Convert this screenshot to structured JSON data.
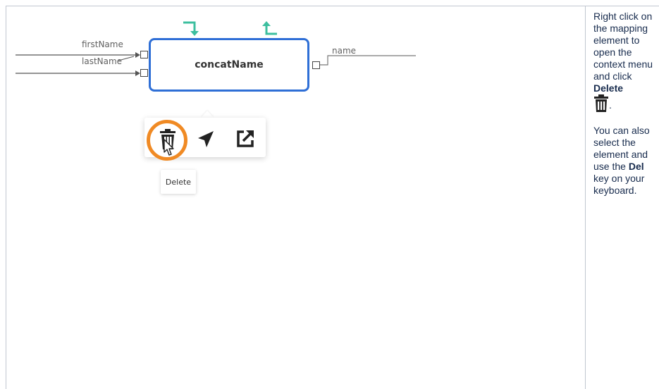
{
  "node": {
    "title": "concatName",
    "inputs": [
      "firstName",
      "lastName"
    ],
    "output": "name"
  },
  "context_menu": {
    "items": [
      {
        "icon": "trash-icon",
        "action": "delete"
      },
      {
        "icon": "navigate-icon",
        "action": "navigate"
      },
      {
        "icon": "open-external-icon",
        "action": "open"
      }
    ],
    "tooltip": "Delete"
  },
  "colors": {
    "node_border": "#2f6fd6",
    "highlight": "#f08a24",
    "flow_arrows": "#3dbf9f"
  },
  "instructions": {
    "line1_prefix": "Right click on the mapping element to open the context menu and click ",
    "line1_bold": "Delete",
    "line1_suffix": ".",
    "line2_prefix": "You can also select the element and use the ",
    "line2_bold": "Del",
    "line2_suffix": " key on your keyboard."
  }
}
